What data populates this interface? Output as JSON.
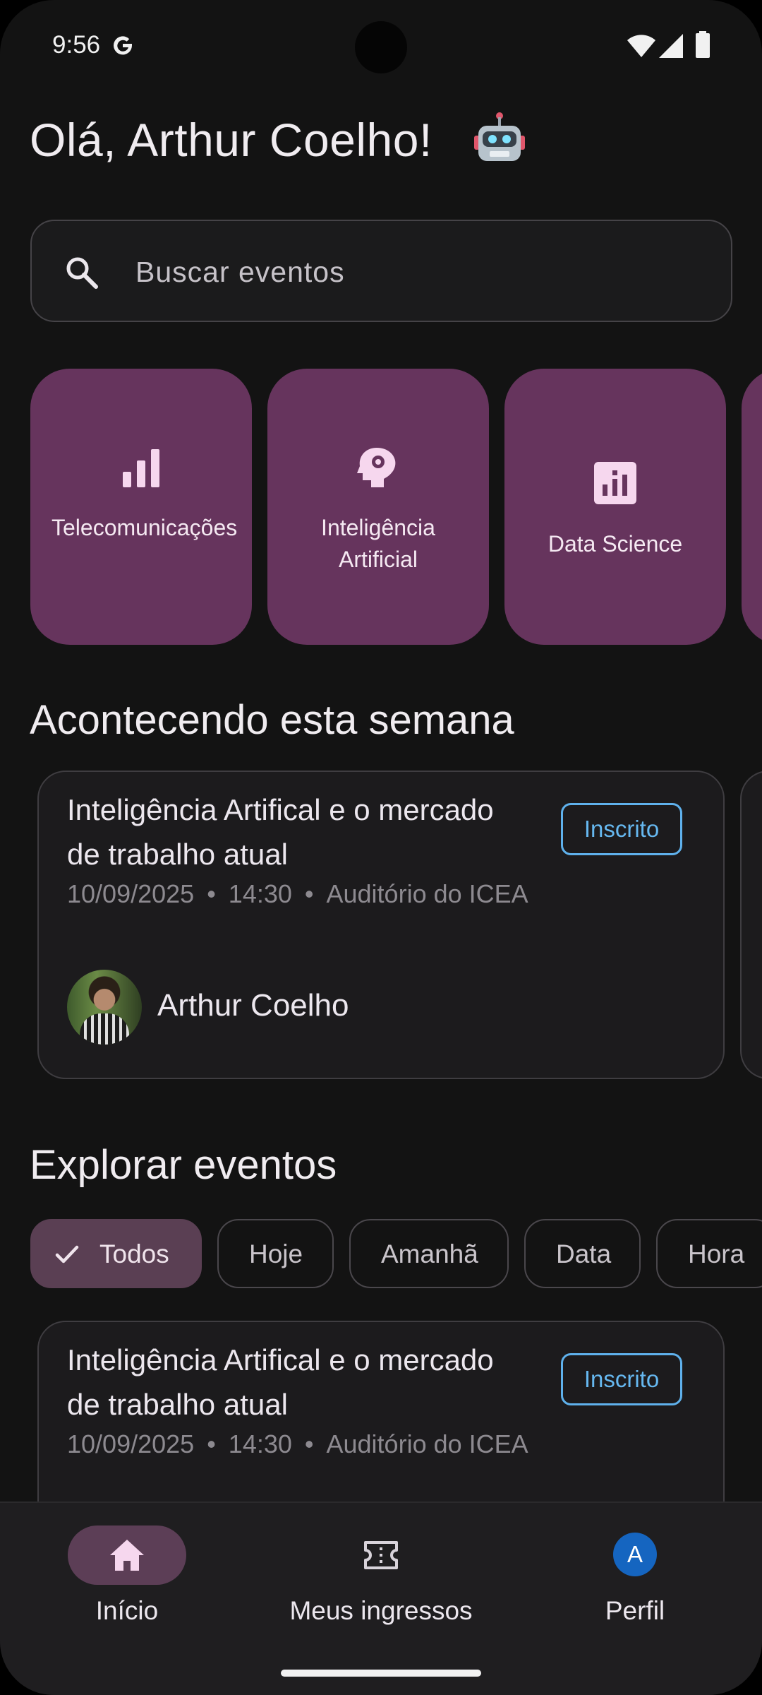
{
  "status_bar": {
    "time": "9:56"
  },
  "greeting": "Olá, Arthur Coelho!",
  "search": {
    "placeholder": "Buscar eventos"
  },
  "categories": [
    {
      "label": "Telecomunicações",
      "icon": "bar-chart-icon"
    },
    {
      "label": "Inteligência Artificial",
      "icon": "psychology-icon"
    },
    {
      "label": "Data Science",
      "icon": "analytics-icon"
    }
  ],
  "this_week": {
    "title": "Acontecendo esta semana",
    "event": {
      "title": "Inteligência Artifical e o mercado de trabalho atual",
      "badge": "Inscrito",
      "date": "10/09/2025",
      "time": "14:30",
      "location": "Auditório do ICEA",
      "organizer": "Arthur Coelho"
    }
  },
  "explore": {
    "title": "Explorar eventos",
    "chips": [
      {
        "label": "Todos",
        "selected": true
      },
      {
        "label": "Hoje",
        "selected": false
      },
      {
        "label": "Amanhã",
        "selected": false
      },
      {
        "label": "Data",
        "selected": false
      },
      {
        "label": "Hora",
        "selected": false
      }
    ],
    "event": {
      "title": "Inteligência Artifical e o mercado de trabalho atual",
      "badge": "Inscrito",
      "date": "10/09/2025",
      "time": "14:30",
      "location": "Auditório do ICEA"
    }
  },
  "bottom_nav": {
    "home": "Início",
    "tickets": "Meus ingressos",
    "profile": "Perfil",
    "profile_initial": "A"
  },
  "colors": {
    "background": "#131313",
    "category_card": "#66345d",
    "badge": "#66b8f0",
    "selected_chip": "#5a3f53"
  }
}
